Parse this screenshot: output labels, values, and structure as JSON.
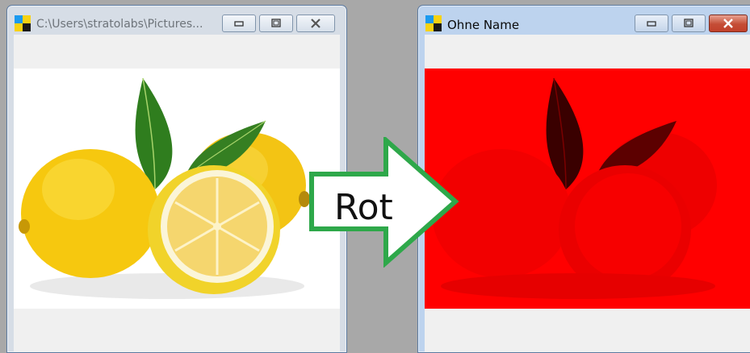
{
  "left_window": {
    "title": "C:\\Users\\stratolabs\\Pictures...",
    "icon": "app-window-icon",
    "buttons": {
      "minimize": "minimize-icon",
      "maximize": "maximize-icon",
      "close": "close-icon"
    }
  },
  "right_window": {
    "title": "Ohne Name",
    "icon": "app-window-icon",
    "buttons": {
      "minimize": "minimize-icon",
      "maximize": "maximize-icon",
      "close": "close-icon"
    }
  },
  "arrow": {
    "label": "Rot",
    "color": "#2ea84a"
  },
  "colors": {
    "red_channel": "#ff0000",
    "lemon": "#f5c518",
    "leaf": "#2f7d1e"
  }
}
